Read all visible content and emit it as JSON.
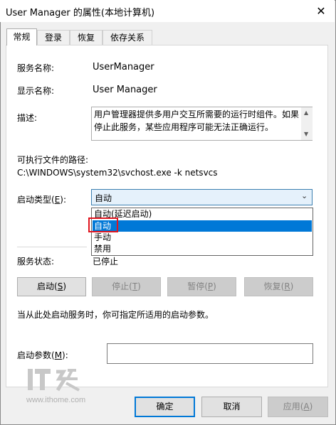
{
  "window": {
    "title": "User Manager 的属性(本地计算机)"
  },
  "tabs": [
    {
      "label": "常规",
      "active": true
    },
    {
      "label": "登录",
      "active": false
    },
    {
      "label": "恢复",
      "active": false
    },
    {
      "label": "依存关系",
      "active": false
    }
  ],
  "general": {
    "service_name_label": "服务名称:",
    "service_name_value": "UserManager",
    "display_name_label": "显示名称:",
    "display_name_value": "User Manager",
    "description_label": "描述:",
    "description_line1": "用户管理器提供多用户交互所需要的运行时组件。如果",
    "description_line2": "停止此服务，某些应用程序可能无法正确运行。",
    "exe_path_label": "可执行文件的路径:",
    "exe_path_value": "C:\\WINDOWS\\system32\\svchost.exe -k netsvcs",
    "startup_type_label": "启动类型(",
    "startup_type_key": "E",
    "startup_type_label_end": "):",
    "startup_type_value": "自动",
    "startup_options": [
      {
        "label": "自动(延迟启动)",
        "selected": false
      },
      {
        "label": "自动",
        "selected": true
      },
      {
        "label": "手动",
        "selected": false
      },
      {
        "label": "禁用",
        "selected": false
      }
    ],
    "service_status_label": "服务状态:",
    "service_status_value": "已停止",
    "buttons": {
      "start": {
        "label": "启动(",
        "key": "S",
        "end": ")"
      },
      "stop": {
        "label": "停止(",
        "key": "T",
        "end": ")"
      },
      "pause": {
        "label": "暂停(",
        "key": "P",
        "end": ")"
      },
      "resume": {
        "label": "恢复(",
        "key": "R",
        "end": ")"
      }
    },
    "hint_text": "当从此处启动服务时，你可指定所适用的启动参数。",
    "start_params_label": "启动参数(",
    "start_params_key": "M",
    "start_params_end": "):",
    "start_params_value": ""
  },
  "footer": {
    "ok_label": "确定",
    "cancel_label": "取消",
    "apply_label": "应用(",
    "apply_key": "A",
    "apply_end": ")"
  },
  "watermark": {
    "logo_text": "IT之家",
    "url": "www.ithome.com"
  },
  "colors": {
    "accent": "#0078d7",
    "highlight_border": "#e0141e"
  }
}
